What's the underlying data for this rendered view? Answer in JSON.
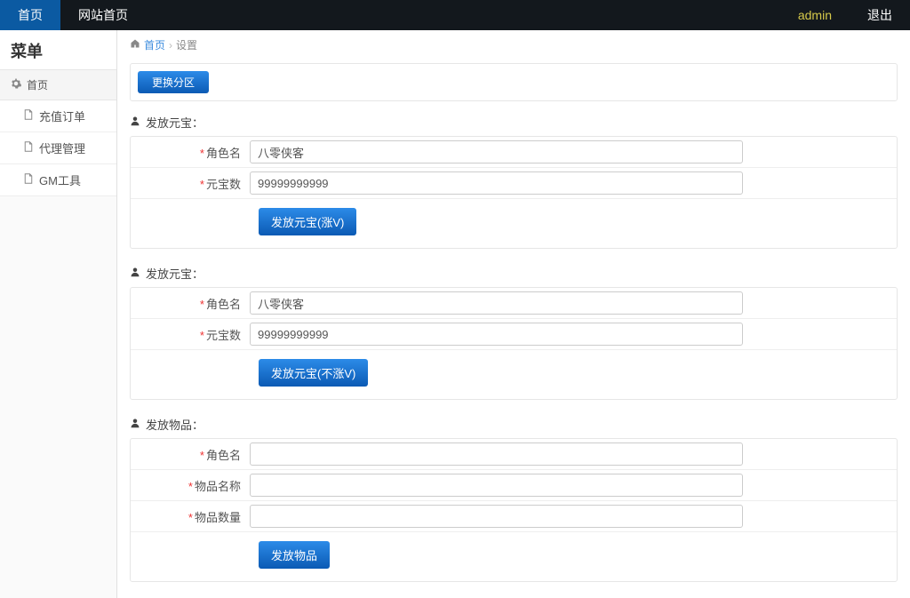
{
  "topnav": {
    "home": "首页",
    "site_home": "网站首页",
    "admin": "admin",
    "logout": "退出"
  },
  "sidebar": {
    "title": "菜单",
    "group_label": "首页",
    "items": [
      {
        "label": "充值订单"
      },
      {
        "label": "代理管理"
      },
      {
        "label": "GM工具"
      }
    ]
  },
  "breadcrumb": {
    "home": "首页",
    "current": "设置"
  },
  "top_button": "更换分区",
  "sections": [
    {
      "title": "发放元宝：",
      "fields": [
        {
          "label": "角色名",
          "value": "八零侠客"
        },
        {
          "label": "元宝数",
          "value": "99999999999"
        }
      ],
      "button": "发放元宝(涨V)"
    },
    {
      "title": "发放元宝：",
      "fields": [
        {
          "label": "角色名",
          "value": "八零侠客"
        },
        {
          "label": "元宝数",
          "value": "99999999999"
        }
      ],
      "button": "发放元宝(不涨V)"
    },
    {
      "title": "发放物品：",
      "fields": [
        {
          "label": "角色名",
          "value": ""
        },
        {
          "label": "物品名称",
          "value": ""
        },
        {
          "label": "物品数量",
          "value": ""
        }
      ],
      "button": "发放物品"
    }
  ]
}
